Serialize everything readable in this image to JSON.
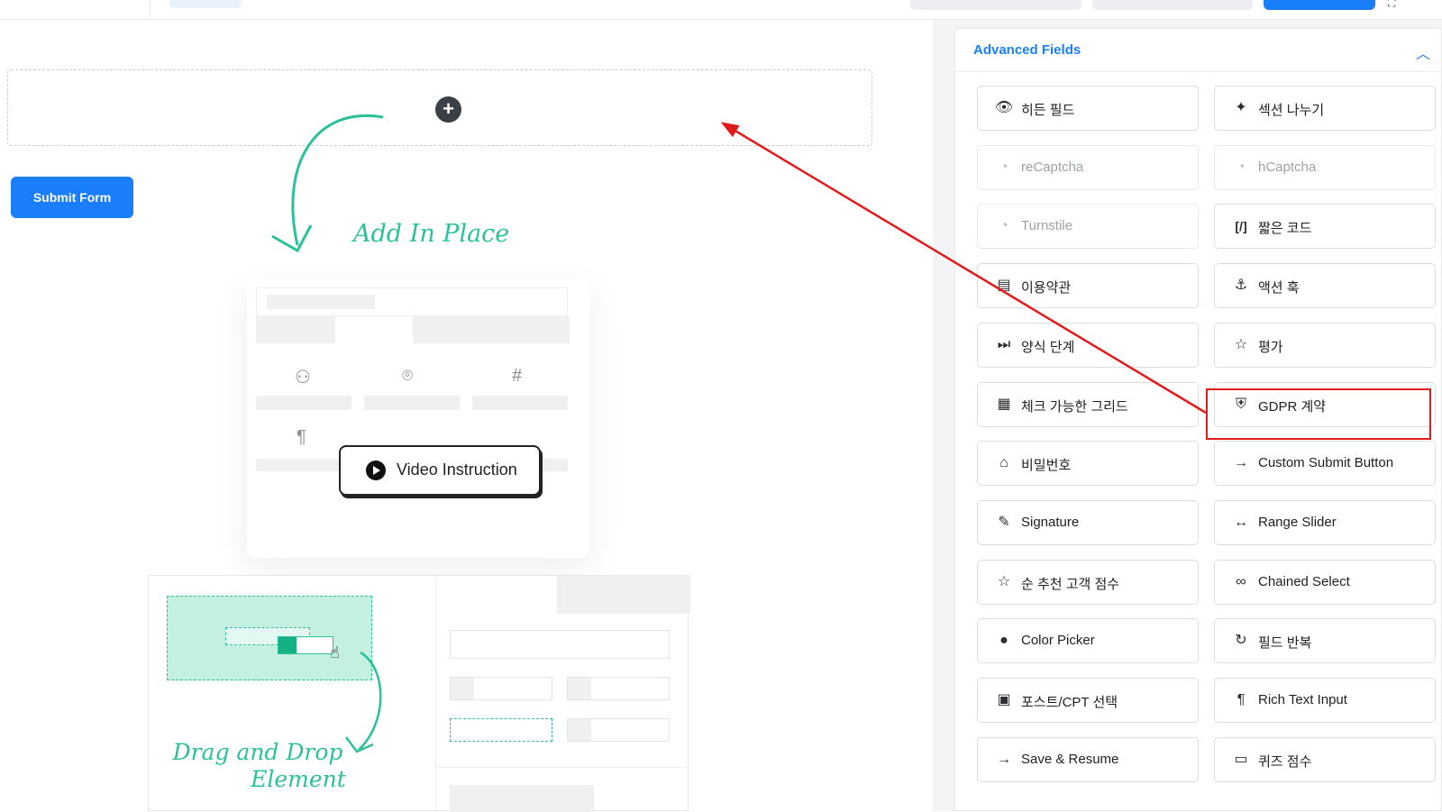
{
  "canvas": {
    "submit_button": "Submit Form",
    "add_in_place_text": "Add In Place",
    "video_instruction_label": "Video Instruction",
    "drag_drop_text_line1": "Drag and Drop",
    "drag_drop_text_line2": "Element"
  },
  "panel": {
    "title": "Advanced Fields",
    "fields": [
      {
        "label": "히든 필드",
        "icon": "eye-slash-icon",
        "enabled": true
      },
      {
        "label": "섹션 나누기",
        "icon": "puzzle-icon",
        "enabled": true
      },
      {
        "label": "reCaptcha",
        "icon": "recaptcha-icon",
        "enabled": false
      },
      {
        "label": "hCaptcha",
        "icon": "hcaptcha-icon",
        "enabled": false
      },
      {
        "label": "Turnstile",
        "icon": "turnstile-icon",
        "enabled": false
      },
      {
        "label": "짧은 코드",
        "icon": "shortcode-icon",
        "enabled": true
      },
      {
        "label": "이용약관",
        "icon": "document-icon",
        "enabled": true
      },
      {
        "label": "액션 훅",
        "icon": "hook-icon",
        "enabled": true
      },
      {
        "label": "양식 단계",
        "icon": "steps-icon",
        "enabled": true
      },
      {
        "label": "평가",
        "icon": "star-icon",
        "enabled": true
      },
      {
        "label": "체크 가능한 그리드",
        "icon": "grid-check-icon",
        "enabled": true
      },
      {
        "label": "GDPR 계약",
        "icon": "shield-icon",
        "enabled": true
      },
      {
        "label": "비밀번호",
        "icon": "lock-icon",
        "enabled": true
      },
      {
        "label": "Custom Submit Button",
        "icon": "arrow-right-icon",
        "enabled": true
      },
      {
        "label": "Signature",
        "icon": "pen-icon",
        "enabled": true
      },
      {
        "label": "Range Slider",
        "icon": "range-icon",
        "enabled": true
      },
      {
        "label": "순 추천 고객 점수",
        "icon": "star-outline-icon",
        "enabled": true
      },
      {
        "label": "Chained Select",
        "icon": "link-icon",
        "enabled": true
      },
      {
        "label": "Color Picker",
        "icon": "drop-icon",
        "enabled": true
      },
      {
        "label": "필드 반복",
        "icon": "repeat-icon",
        "enabled": true
      },
      {
        "label": "포스트/CPT 선택",
        "icon": "post-select-icon",
        "enabled": true
      },
      {
        "label": "Rich Text Input",
        "icon": "paragraph-icon",
        "enabled": true
      },
      {
        "label": "Save & Resume",
        "icon": "arrow-right-icon",
        "enabled": true
      },
      {
        "label": "퀴즈 점수",
        "icon": "quiz-icon",
        "enabled": true
      }
    ]
  },
  "annotation": {
    "highlight_color": "#e01b1b",
    "highlighted_field": "GDPR 계약"
  },
  "colors": {
    "accent": "#1a7efb",
    "illustration_green": "#2cc09b"
  }
}
